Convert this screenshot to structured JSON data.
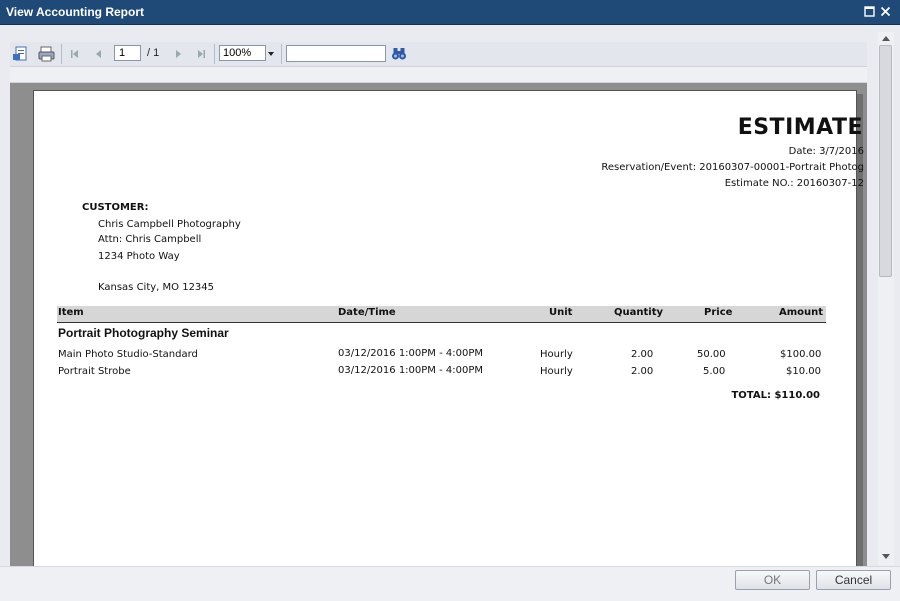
{
  "window": {
    "title": "View Accounting Report"
  },
  "toolbar": {
    "page_value": "1",
    "page_count": "/ 1",
    "zoom_value": "100%",
    "search_value": ""
  },
  "report": {
    "heading": "ESTIMATE",
    "date": "Date: 3/7/2016",
    "reservation": "Reservation/Event: 20160307-00001-Portrait Photog",
    "estimate_no": "Estimate NO.: 20160307-12",
    "customer_label": "CUSTOMER:",
    "customer_lines": [
      "Chris Campbell Photography",
      "Attn: Chris Campbell",
      "1234 Photo Way",
      "Kansas City, MO 12345"
    ],
    "columns": [
      "Item",
      "Date/Time",
      "Unit",
      "Quantity",
      "Price",
      "Amount"
    ],
    "section_title": "Portrait Photography Seminar",
    "rows": [
      {
        "item": "Main Photo Studio-Standard",
        "datetime": "03/12/2016  1:00PM -  4:00PM",
        "unit": "Hourly",
        "quantity": "2.00",
        "price": "50.00",
        "amount": "$100.00"
      },
      {
        "item": "Portrait Strobe",
        "datetime": "03/12/2016  1:00PM -  4:00PM",
        "unit": "Hourly",
        "quantity": "2.00",
        "price": "5.00",
        "amount": "$10.00"
      }
    ],
    "total": "TOTAL: $110.00"
  },
  "footer": {
    "ok_label": "OK",
    "cancel_label": "Cancel"
  }
}
